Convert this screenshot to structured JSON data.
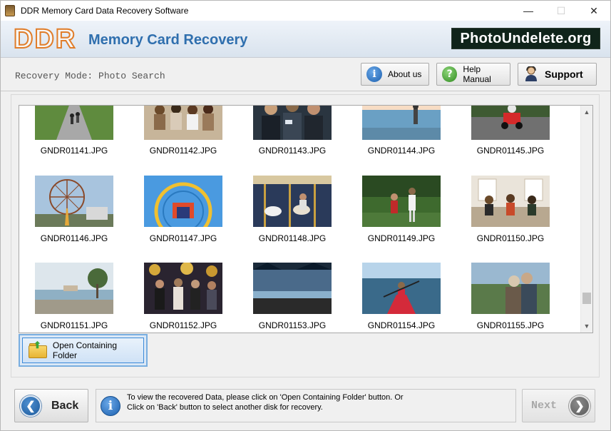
{
  "window": {
    "title": "DDR Memory Card Data Recovery Software",
    "minimize": "—",
    "maximize": "☐",
    "close": "✕"
  },
  "banner": {
    "logo": "DDR",
    "title": "Memory Card Recovery",
    "site": "PhotoUndelete.org"
  },
  "mode": {
    "label": "Recovery Mode: Photo Search"
  },
  "toolbar": {
    "about_label": "About us",
    "help_label": "Help Manual",
    "support_label": "Support"
  },
  "gallery": {
    "items": [
      {
        "name": "GNDR01141.JPG",
        "scene": "road"
      },
      {
        "name": "GNDR01142.JPG",
        "scene": "group"
      },
      {
        "name": "GNDR01143.JPG",
        "scene": "dark-group"
      },
      {
        "name": "GNDR01144.JPG",
        "scene": "beach"
      },
      {
        "name": "GNDR01145.JPG",
        "scene": "kart"
      },
      {
        "name": "GNDR01146.JPG",
        "scene": "ferris"
      },
      {
        "name": "GNDR01147.JPG",
        "scene": "ride"
      },
      {
        "name": "GNDR01148.JPG",
        "scene": "carousel"
      },
      {
        "name": "GNDR01149.JPG",
        "scene": "park"
      },
      {
        "name": "GNDR01150.JPG",
        "scene": "sofa"
      },
      {
        "name": "GNDR01151.JPG",
        "scene": "waterfront"
      },
      {
        "name": "GNDR01152.JPG",
        "scene": "party"
      },
      {
        "name": "GNDR01153.JPG",
        "scene": "lake"
      },
      {
        "name": "GNDR01154.JPG",
        "scene": "kayak"
      },
      {
        "name": "GNDR01155.JPG",
        "scene": "couple"
      }
    ]
  },
  "actions": {
    "open_folder_label": "Open Containing Folder"
  },
  "footer": {
    "back_label": "Back",
    "next_label": "Next",
    "info_line1": "To view the recovered Data, please click on 'Open Containing Folder' button. Or",
    "info_line2": "Click on 'Back' button to select another disk for recovery."
  },
  "colors": {
    "accent_blue": "#2f6fae",
    "logo_orange": "#e07d2a",
    "badge_bg": "#10241a"
  }
}
